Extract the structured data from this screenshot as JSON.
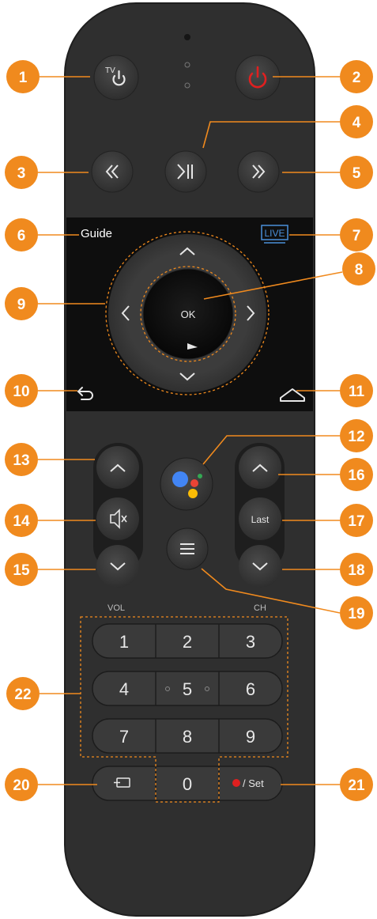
{
  "colors": {
    "accent": "#f08a1e",
    "body": "#2e2e2e",
    "panel": "#101010",
    "button": "#3a3a3a",
    "power": "#e02020"
  },
  "labels": {
    "guide": "Guide",
    "live": "LIVE",
    "ok": "OK",
    "tv": "TV",
    "last": "Last",
    "vol": "VOL",
    "ch": "CH",
    "set": "/ Set"
  },
  "numpad": [
    "1",
    "2",
    "3",
    "4",
    "5",
    "6",
    "7",
    "8",
    "9",
    "0"
  ],
  "callouts": [
    "1",
    "2",
    "3",
    "4",
    "5",
    "6",
    "7",
    "8",
    "9",
    "10",
    "11",
    "12",
    "13",
    "14",
    "15",
    "16",
    "17",
    "18",
    "19",
    "20",
    "21",
    "22"
  ]
}
